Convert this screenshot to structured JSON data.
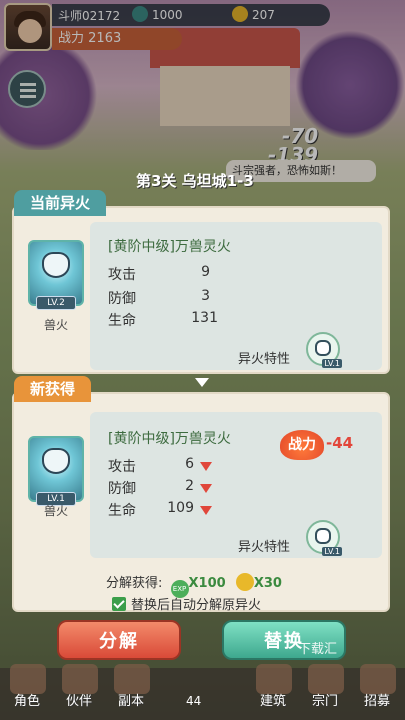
{
  "player": {
    "name": "斗师02172",
    "power_label": "战力",
    "power": "2163",
    "jade": "1000",
    "gold": "207"
  },
  "stage": {
    "title": "第3关 乌坦城1-3"
  },
  "battle": {
    "damage1": "-70",
    "damage2": "-139",
    "speech": "斗宗强者，恐怖如斯！"
  },
  "current": {
    "tag": "当前异火",
    "fire_label": "兽火",
    "level": "LV.2",
    "name": "[黄阶中级]万兽灵火",
    "stats": [
      {
        "label": "攻击",
        "value": "9"
      },
      {
        "label": "防御",
        "value": "3"
      },
      {
        "label": "生命",
        "value": "131"
      }
    ],
    "trait_label": "异火特性",
    "trait_level": "LV.1"
  },
  "new": {
    "tag": "新获得",
    "fire_label": "兽火",
    "level": "LV.1",
    "name": "[黄阶中级]万兽灵火",
    "power_label": "战力",
    "power_diff": "-44",
    "stats": [
      {
        "label": "攻击",
        "value": "6"
      },
      {
        "label": "防御",
        "value": "2"
      },
      {
        "label": "生命",
        "value": "109"
      }
    ],
    "trait_label": "异火特性",
    "trait_level": "LV.1"
  },
  "decompose": {
    "label": "分解获得:",
    "exp_icon": "EXP",
    "exp_qty": "X100",
    "gold_qty": "X30"
  },
  "auto_option": {
    "label": "替换后自动分解原异火",
    "checked": true
  },
  "buttons": {
    "decompose": "分解",
    "replace": "替换"
  },
  "nav": {
    "items": [
      "角色",
      "伙伴",
      "副本",
      "建筑",
      "宗门",
      "招募"
    ],
    "counter": "44"
  },
  "watermark": "下载汇",
  "colors": {
    "tag_teal": "#4f9ea0",
    "tag_orange": "#e8943a",
    "primary_red": "#d94a38",
    "primary_green": "#3ea88e"
  }
}
